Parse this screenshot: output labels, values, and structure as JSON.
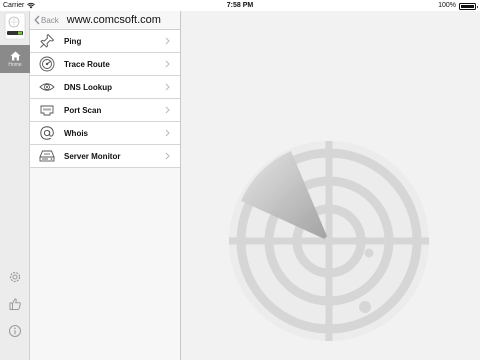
{
  "status_bar": {
    "carrier": "Carrier",
    "time": "7:58 PM",
    "battery": "100%",
    "battery_level": 1.0
  },
  "rail": {
    "home_label": "Home",
    "icons": [
      "settings-icon",
      "thumbs-up-icon",
      "info-icon"
    ]
  },
  "navbar": {
    "back_label": "Back",
    "title": "www.comcsoft.com"
  },
  "menu": {
    "items": [
      {
        "label": "Ping",
        "icon": "pin-icon"
      },
      {
        "label": "Trace Route",
        "icon": "trace-icon"
      },
      {
        "label": "DNS Lookup",
        "icon": "eye-icon"
      },
      {
        "label": "Port Scan",
        "icon": "port-icon"
      },
      {
        "label": "Whois",
        "icon": "at-icon"
      },
      {
        "label": "Server Monitor",
        "icon": "server-icon"
      }
    ]
  },
  "colors": {
    "rail_bg": "#ececec",
    "home_tab_bg": "#8a8a8a",
    "chevron": "#b8b8bd",
    "back_gray": "#8e8e93",
    "radar_gray": "#dcdcdc"
  }
}
